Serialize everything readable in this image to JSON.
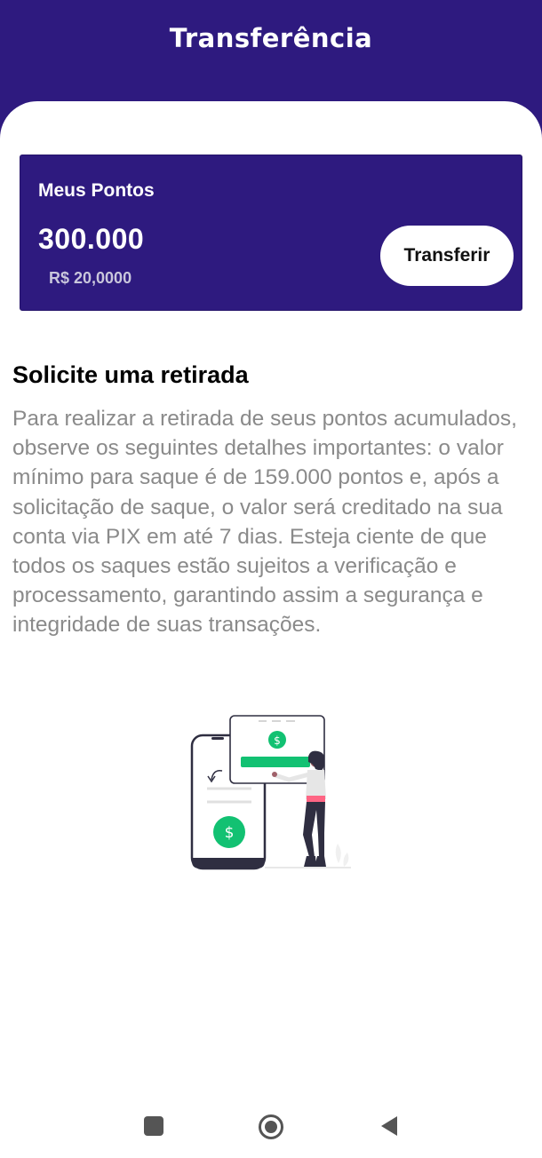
{
  "header": {
    "title": "Transferência"
  },
  "points_card": {
    "label": "Meus Pontos",
    "value": "300.000",
    "money": "R$ 20,0000",
    "transfer_label": "Transferir"
  },
  "withdraw": {
    "title": "Solicite uma retirada",
    "body": "Para realizar a retirada de seus pontos acumulados, observe os seguintes detalhes importantes: o valor mínimo para saque é de 159.000 pontos e, após a solicitação de saque, o valor será creditado na sua conta via PIX em até 7 dias. Esteja ciente de que todos os saques estão sujeitos a verificação e processamento, garantindo assim a segurança e integridade de suas transações."
  },
  "illustration": {
    "icon": "money-transfer-illustration",
    "currency_symbol": "$"
  },
  "navbar": {
    "recents_icon": "square-icon",
    "home_icon": "circle-icon",
    "back_icon": "triangle-back-icon"
  },
  "colors": {
    "primary": "#2e1a7f",
    "accent_green": "#12c172",
    "text_gray": "#8a8a8a"
  }
}
